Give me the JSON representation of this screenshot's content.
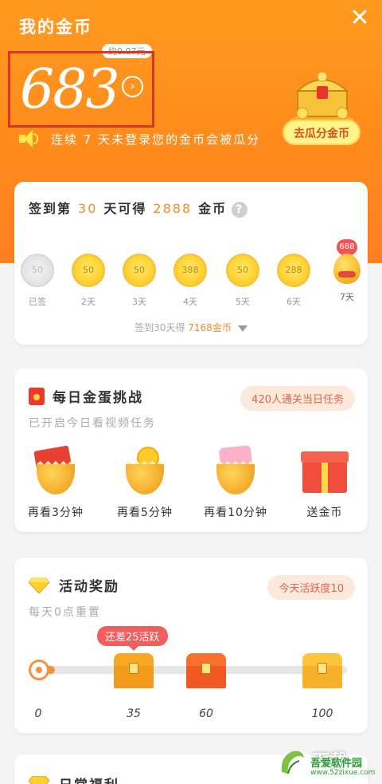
{
  "header": {
    "title": "我的金币",
    "close_symbol": "✕",
    "coin_value": "683",
    "approx_tag": "约0.07元",
    "arrow_symbol": "›",
    "warning": "连续 7 天未登录您的金币会被瓜分",
    "divide_button": "去瓜分金币"
  },
  "signin": {
    "prefix": "签到第",
    "day_num": "30",
    "middle": "天可得",
    "coins": "2888",
    "suffix": "金币",
    "help_symbol": "?",
    "days": [
      {
        "value": "50",
        "label": "已签",
        "done": true
      },
      {
        "value": "50",
        "label": "2天",
        "done": false
      },
      {
        "value": "50",
        "label": "3天",
        "done": false
      },
      {
        "value": "388",
        "label": "4天",
        "done": false
      },
      {
        "value": "50",
        "label": "5天",
        "done": false
      },
      {
        "value": "288",
        "label": "6天",
        "done": false
      }
    ],
    "day7": {
      "badge": "688",
      "label": "7天"
    },
    "footer_prefix": "签到30天得",
    "footer_highlight": "7168金币"
  },
  "challenge": {
    "title": "每日金蛋挑战",
    "pill": "420人通关当日任务",
    "subtitle": "已开启今日看视频任务",
    "tasks": [
      {
        "label": "再看3分钟",
        "icon": "egg-red-envelope"
      },
      {
        "label": "再看5分钟",
        "icon": "egg-coins"
      },
      {
        "label": "再看10分钟",
        "icon": "egg-pink-gift"
      },
      {
        "label": "送金币",
        "icon": "gift-box"
      }
    ]
  },
  "activity": {
    "title": "活动奖励",
    "pill": "今天活跃度10",
    "subtitle": "每天0点重置",
    "bubble": "还差25活跃",
    "progress": 10,
    "milestones": [
      "0",
      "35",
      "60",
      "100"
    ]
  },
  "daily": {
    "title": "日常福利"
  },
  "watermark": {
    "title": "下载",
    "name": "吾爱软件园",
    "url": "www.52zixue.com"
  },
  "colors": {
    "header_orange": "#ff8a1c",
    "accent": "#f08c2e",
    "red": "#f25454"
  }
}
